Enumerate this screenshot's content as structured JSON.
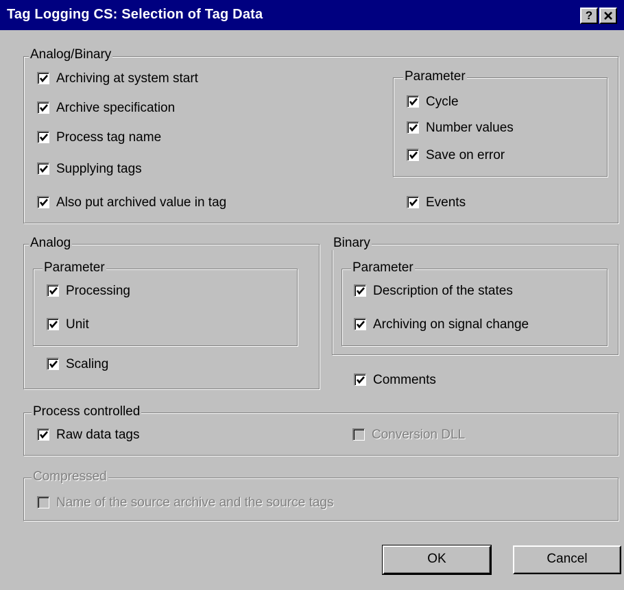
{
  "window": {
    "title": "Tag Logging CS: Selection of Tag Data",
    "help_label": "?",
    "close_label": "✕"
  },
  "analog_binary": {
    "legend": "Analog/Binary",
    "items": [
      {
        "label": "Archiving at system start",
        "checked": true
      },
      {
        "label": "Archive specification",
        "checked": true
      },
      {
        "label": "Process tag name",
        "checked": true
      },
      {
        "label": "Supplying tags",
        "checked": true
      },
      {
        "label": "Also put archived value in tag",
        "checked": true
      }
    ],
    "parameter": {
      "legend": "Parameter",
      "items": [
        {
          "label": "Cycle",
          "checked": true
        },
        {
          "label": "Number values",
          "checked": true
        },
        {
          "label": "Save on error",
          "checked": true
        }
      ]
    },
    "events": {
      "label": "Events",
      "checked": true
    }
  },
  "analog": {
    "legend": "Analog",
    "parameter": {
      "legend": "Parameter",
      "items": [
        {
          "label": "Processing",
          "checked": true
        },
        {
          "label": "Unit",
          "checked": true
        }
      ]
    },
    "scaling": {
      "label": "Scaling",
      "checked": true
    }
  },
  "binary": {
    "legend": "Binary",
    "parameter": {
      "legend": "Parameter",
      "items": [
        {
          "label": "Description of the states",
          "checked": true
        },
        {
          "label": "Archiving on signal change",
          "checked": true
        }
      ]
    },
    "comments": {
      "label": "Comments",
      "checked": true
    }
  },
  "process_controlled": {
    "legend": "Process controlled",
    "raw_data_tags": {
      "label": "Raw data tags",
      "checked": true
    },
    "conversion_dll": {
      "label": "Conversion DLL",
      "checked": false,
      "disabled": true
    }
  },
  "compressed": {
    "legend": "Compressed",
    "disabled": true,
    "source": {
      "label": "Name of the source archive and the source tags",
      "checked": false,
      "disabled": true
    }
  },
  "buttons": {
    "ok": "OK",
    "cancel": "Cancel"
  },
  "colors": {
    "titlebar": "#000080",
    "face": "#c0c0c0",
    "disabled_text": "#808080"
  }
}
